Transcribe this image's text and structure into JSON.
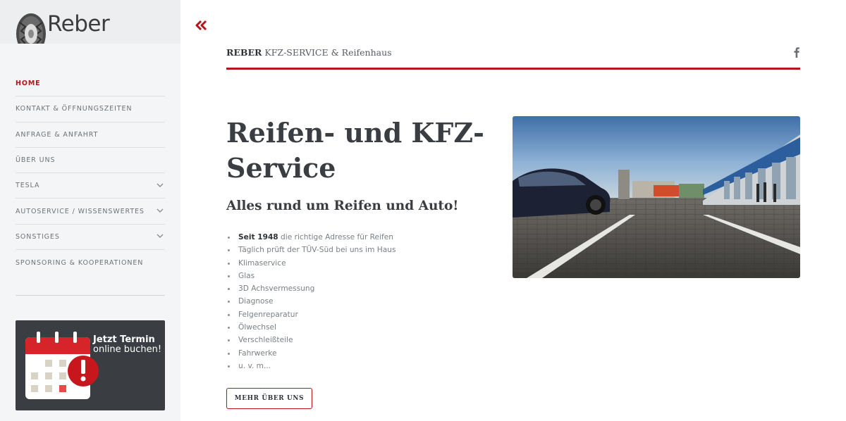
{
  "sidebar": {
    "logo_text": "Reber",
    "nav": [
      {
        "label": "HOME",
        "active": true
      },
      {
        "label": "KONTAKT & ÖFFNUNGSZEITEN"
      },
      {
        "label": "ANFRAGE & ANFAHRT"
      },
      {
        "label": "ÜBER UNS"
      },
      {
        "label": "TESLA",
        "has_submenu": true
      },
      {
        "label": "AUTOSERVICE / WISSENSWERTES",
        "has_submenu": true
      },
      {
        "label": "SONSTIGES",
        "has_submenu": true
      },
      {
        "label": "SPONSORING & KOOPERATIONEN"
      }
    ],
    "banner": {
      "title": "Jetzt Termin",
      "subtitle": "online buchen!"
    }
  },
  "header": {
    "brand_strong": "REBER",
    "brand_rest": " KFZ-SERVICE & Reifenhaus",
    "social_icon": "facebook-icon"
  },
  "main": {
    "title": "Reifen- und KFZ-Service",
    "subtitle": "Alles rund um Reifen und Auto!",
    "features": [
      {
        "strong": "Seit 1948",
        "text": " die richtige Adresse für Reifen"
      },
      {
        "text": "Täglich prüft der TÜV-Süd bei uns im Haus"
      },
      {
        "text": "Klimaservice"
      },
      {
        "text": "Glas"
      },
      {
        "text": "3D Achsvermessung"
      },
      {
        "text": "Diagnose"
      },
      {
        "text": "Felgenreparatur"
      },
      {
        "text": "Ölwechsel"
      },
      {
        "text": "Verschleißteile"
      },
      {
        "text": "Fahrwerke"
      },
      {
        "text": "u. v. m..."
      }
    ],
    "button_label": "MEHR ÜBER UNS"
  },
  "colors": {
    "accent": "#b7141c",
    "sidebar_bg": "#f4f5f6",
    "heading": "#3a3e42",
    "banner_bg": "#3a3e42"
  }
}
